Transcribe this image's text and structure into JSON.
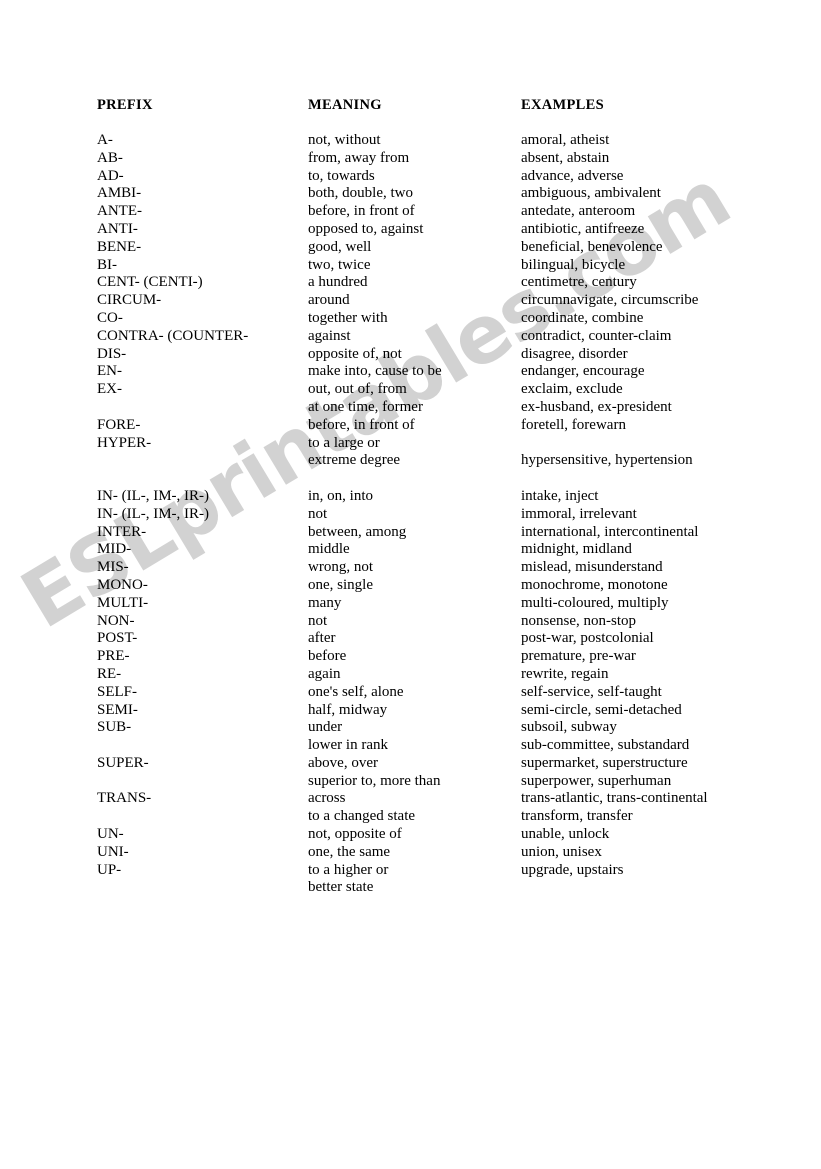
{
  "document": {
    "title": "Prefixes",
    "watermark": "ESLprintables.com",
    "watermark_color": "#d2d2d2"
  },
  "table": {
    "headers": {
      "prefix": "PREFIX",
      "meaning": "MEANING",
      "examples": "EXAMPLES"
    },
    "rows": [
      {
        "prefix": "A-",
        "meaning": "not, without",
        "examples": "amoral, atheist"
      },
      {
        "prefix": "AB-",
        "meaning": "from, away from",
        "examples": "absent, abstain"
      },
      {
        "prefix": "AD-",
        "meaning": "to, towards",
        "examples": "advance, adverse"
      },
      {
        "prefix": "AMBI-",
        "meaning": "both, double, two",
        "examples": "ambiguous, ambivalent"
      },
      {
        "prefix": "ANTE-",
        "meaning": "before, in front of",
        "examples": "antedate, anteroom"
      },
      {
        "prefix": "ANTI-",
        "meaning": "opposed to, against",
        "examples": "antibiotic, antifreeze"
      },
      {
        "prefix": "BENE-",
        "meaning": "good, well",
        "examples": "beneficial, benevolence"
      },
      {
        "prefix": "BI-",
        "meaning": "two, twice",
        "examples": "bilingual, bicycle"
      },
      {
        "prefix": "CENT- (CENTI-)",
        "meaning": "a hundred",
        "examples": "centimetre, century"
      },
      {
        "prefix": "CIRCUM-",
        "meaning": "around",
        "examples": "circumnavigate, circumscribe"
      },
      {
        "prefix": "CO-",
        "meaning": "together with",
        "examples": "coordinate, combine"
      },
      {
        "prefix": "CONTRA- (COUNTER-",
        "meaning": "against",
        "examples": "contradict, counter-claim"
      },
      {
        "prefix": "DIS-",
        "meaning": "opposite of, not",
        "examples": "disagree, disorder"
      },
      {
        "prefix": "EN-",
        "meaning": "make into, cause to be",
        "examples": "endanger, encourage"
      },
      {
        "prefix": "EX-",
        "meaning": "out, out of, from",
        "examples": "exclaim, exclude"
      },
      {
        "prefix": "",
        "meaning": "at one time, former",
        "examples": "ex-husband, ex-president"
      },
      {
        "prefix": "FORE-",
        "meaning": "before, in front of",
        "examples": "foretell, forewarn"
      },
      {
        "prefix": "HYPER-",
        "meaning": "to a large or",
        "examples": ""
      },
      {
        "prefix": "",
        "meaning": "extreme degree",
        "examples": "hypersensitive, hypertension"
      },
      {
        "prefix": "",
        "meaning": "",
        "examples": ""
      },
      {
        "prefix": "IN- (IL-, IM-, IR-)",
        "meaning": "in, on, into",
        "examples": "intake, inject"
      },
      {
        "prefix": "IN- (IL-, IM-, IR-)",
        "meaning": "not",
        "examples": "immoral, irrelevant"
      },
      {
        "prefix": "INTER-",
        "meaning": "between, among",
        "examples": "international, intercontinental"
      },
      {
        "prefix": "MID-",
        "meaning": "middle",
        "examples": "midnight, midland"
      },
      {
        "prefix": "MIS-",
        "meaning": "wrong, not",
        "examples": "mislead, misunderstand"
      },
      {
        "prefix": "MONO-",
        "meaning": "one, single",
        "examples": "monochrome, monotone"
      },
      {
        "prefix": "MULTI-",
        "meaning": "many",
        "examples": "multi-coloured, multiply"
      },
      {
        "prefix": "NON-",
        "meaning": "not",
        "examples": "nonsense, non-stop"
      },
      {
        "prefix": "POST-",
        "meaning": "after",
        "examples": "post-war, postcolonial"
      },
      {
        "prefix": "PRE-",
        "meaning": "before",
        "examples": "premature, pre-war"
      },
      {
        "prefix": "RE-",
        "meaning": "again",
        "examples": "rewrite, regain"
      },
      {
        "prefix": "SELF-",
        "meaning": "one's self, alone",
        "examples": "self-service, self-taught"
      },
      {
        "prefix": "SEMI-",
        "meaning": "half, midway",
        "examples": "semi-circle, semi-detached"
      },
      {
        "prefix": "SUB-",
        "meaning": "under",
        "examples": "subsoil, subway"
      },
      {
        "prefix": "",
        "meaning": "lower in rank",
        "examples": "sub-committee, substandard"
      },
      {
        "prefix": "SUPER-",
        "meaning": "above, over",
        "examples": "supermarket, superstructure"
      },
      {
        "prefix": "",
        "meaning": "superior to, more than",
        "examples": "superpower, superhuman"
      },
      {
        "prefix": "TRANS-",
        "meaning": "across",
        "examples": "trans-atlantic, trans-continental"
      },
      {
        "prefix": "",
        "meaning": "to a changed state",
        "examples": "transform, transfer"
      },
      {
        "prefix": "UN-",
        "meaning": "not, opposite of",
        "examples": "unable, unlock"
      },
      {
        "prefix": "UNI-",
        "meaning": "one, the same",
        "examples": "union, unisex"
      },
      {
        "prefix": "UP-",
        "meaning": "to a higher or",
        "examples": "upgrade, upstairs"
      },
      {
        "prefix": "",
        "meaning": "better state",
        "examples": ""
      }
    ]
  }
}
